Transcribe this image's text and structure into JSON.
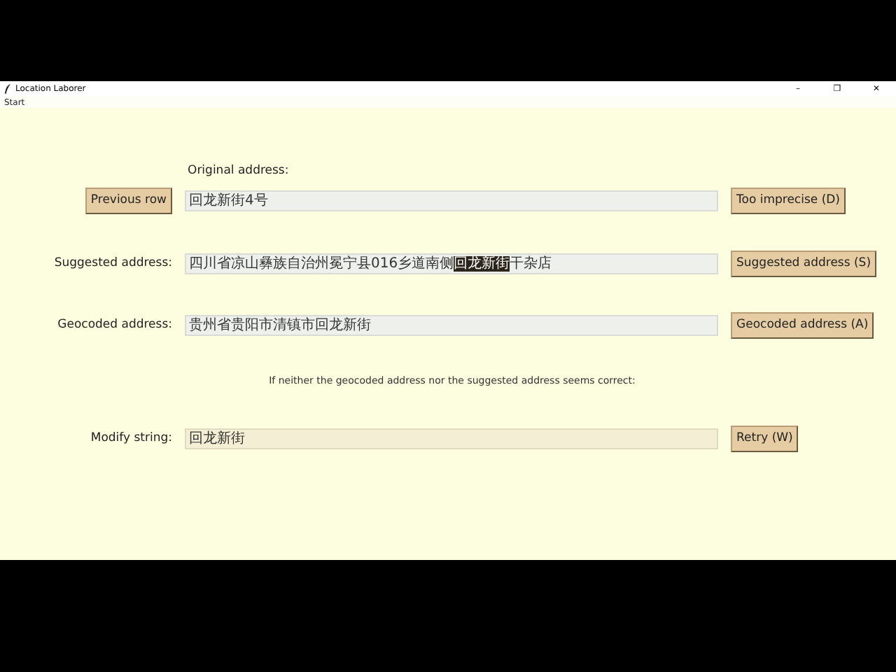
{
  "window": {
    "title": "Location Laborer",
    "controls": [
      "–",
      "❐",
      "✕"
    ]
  },
  "menu": [
    "Start"
  ],
  "original": {
    "label": "Original address:",
    "button": "Previous row",
    "value": "回龙新街4号",
    "action": "Too imprecise (D)"
  },
  "suggested": {
    "label": "Suggested address:",
    "segments": [
      {
        "text": "四川省凉山彝族自治州冕宁县016乡道南侧",
        "selected": false
      },
      {
        "text": "回龙新街",
        "selected": true
      },
      {
        "text": "干杂店",
        "selected": false
      }
    ],
    "action": "Suggested address (S)"
  },
  "geocoded": {
    "label": "Geocoded address:",
    "value": "贵州省贵阳市清镇市回龙新街",
    "action": "Geocoded address (A)"
  },
  "note": "If neither the geocoded address nor the suggested address seems correct:",
  "modify": {
    "label": "Modify string:",
    "value": "回龙新街",
    "action": "Retry (W)"
  }
}
